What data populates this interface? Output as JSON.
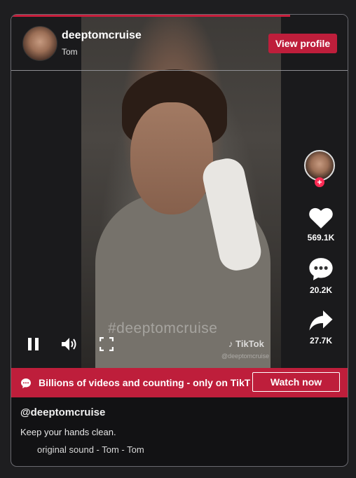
{
  "author": {
    "username": "deeptomcruise",
    "nickname": "Tom",
    "view_profile_label": "View profile"
  },
  "video": {
    "progress_fraction": 0.83,
    "watermark_text": "#deeptomcruise",
    "brand": "TikTok",
    "brand_handle": "@deeptomcruise"
  },
  "actions": {
    "likes": "569.1K",
    "comments": "20.2K",
    "shares": "27.7K"
  },
  "icons": {
    "like": "heart-icon",
    "comment": "comment-bubble-icon",
    "share": "share-arrow-icon",
    "pause": "pause-icon",
    "volume": "volume-icon",
    "fullscreen": "fullscreen-icon",
    "banner": "chat-bubble-icon"
  },
  "banner": {
    "text": "Billions of videos and counting - only on TikTok",
    "watch_now_label": "Watch now"
  },
  "caption": {
    "username": "@deeptomcruise",
    "text": "Keep your hands clean.",
    "music": "original sound - Tom - Tom"
  },
  "colors": {
    "accent": "#be1e3b",
    "background": "#1e1e20"
  }
}
